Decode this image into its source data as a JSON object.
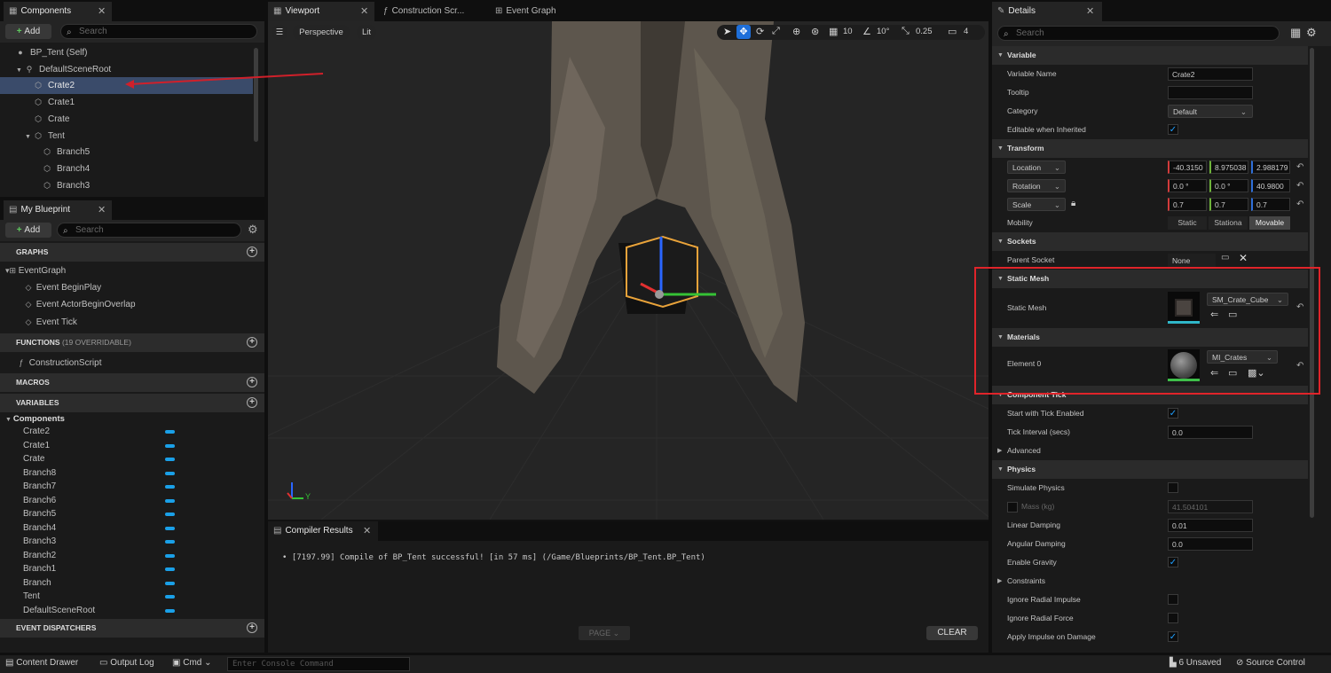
{
  "components": {
    "tab": "Components",
    "add": "Add",
    "search_placeholder": "Search",
    "tree": [
      {
        "label": "BP_Tent (Self)",
        "icon": "actor-icon",
        "indent": 0
      },
      {
        "label": "DefaultSceneRoot",
        "icon": "scene-root-icon",
        "indent": 1
      },
      {
        "label": "Crate2",
        "icon": "static-mesh-icon",
        "indent": 2,
        "selected": true
      },
      {
        "label": "Crate1",
        "icon": "static-mesh-icon",
        "indent": 2
      },
      {
        "label": "Crate",
        "icon": "static-mesh-icon",
        "indent": 2
      },
      {
        "label": "Tent",
        "icon": "static-mesh-icon",
        "indent": 2
      },
      {
        "label": "Branch5",
        "icon": "static-mesh-icon",
        "indent": 3
      },
      {
        "label": "Branch4",
        "icon": "static-mesh-icon",
        "indent": 3
      },
      {
        "label": "Branch3",
        "icon": "static-mesh-icon",
        "indent": 3
      }
    ]
  },
  "my_blueprint": {
    "tab": "My Blueprint",
    "add": "Add",
    "search_placeholder": "Search",
    "graphs_header": "GRAPHS",
    "event_graph": "EventGraph",
    "events": [
      "Event BeginPlay",
      "Event ActorBeginOverlap",
      "Event Tick"
    ],
    "functions_header": "FUNCTIONS",
    "functions_count": "(19 OVERRIDABLE)",
    "construction_script": "ConstructionScript",
    "macros_header": "MACROS",
    "variables_header": "VARIABLES",
    "components_group": "Components",
    "variables": [
      "Crate2",
      "Crate1",
      "Crate",
      "Branch8",
      "Branch7",
      "Branch6",
      "Branch5",
      "Branch4",
      "Branch3",
      "Branch2",
      "Branch1",
      "Branch",
      "Tent",
      "DefaultSceneRoot"
    ],
    "dispatchers_header": "EVENT DISPATCHERS",
    "var_color": "#1aa0e8"
  },
  "editor_tabs": {
    "viewport": "Viewport",
    "construction": "Construction Scr...",
    "event_graph": "Event Graph"
  },
  "viewport": {
    "perspective": "Perspective",
    "lit": "Lit",
    "grid_snap": "10",
    "rot_snap": "10°",
    "scale_snap": "0.25",
    "camera_speed": "4",
    "axis_y": "Y"
  },
  "compiler": {
    "tab": "Compiler Results",
    "message": "• [7197.99] Compile of BP_Tent successful! [in 57 ms] (/Game/Blueprints/BP_Tent.BP_Tent)",
    "page": "PAGE",
    "clear": "CLEAR"
  },
  "details": {
    "tab": "Details",
    "search_placeholder": "Search",
    "variable": {
      "header": "Variable",
      "name_label": "Variable Name",
      "name_value": "Crate2",
      "tooltip_label": "Tooltip",
      "category_label": "Category",
      "category_value": "Default",
      "editable_label": "Editable when Inherited",
      "editable_checked": true
    },
    "transform": {
      "header": "Transform",
      "location": "Location",
      "location_values": [
        "-40.3150",
        "8.975038",
        "2.988179"
      ],
      "rotation": "Rotation",
      "rotation_values": [
        "0.0 °",
        "0.0 °",
        "40.9800"
      ],
      "scale": "Scale",
      "scale_values": [
        "0.7",
        "0.7",
        "0.7"
      ],
      "mobility_label": "Mobility",
      "mobility_options": [
        "Static",
        "Stationa",
        "Movable"
      ],
      "mobility_selected": "Movable"
    },
    "sockets": {
      "header": "Sockets",
      "parent_label": "Parent Socket",
      "parent_value": "None"
    },
    "static_mesh": {
      "header": "Static Mesh",
      "label": "Static Mesh",
      "value": "SM_Crate_Cube"
    },
    "materials": {
      "header": "Materials",
      "label": "Element 0",
      "value": "MI_Crates"
    },
    "component_tick": {
      "header": "Component Tick",
      "start_label": "Start with Tick Enabled",
      "start_checked": true,
      "interval_label": "Tick Interval (secs)",
      "interval_value": "0.0"
    },
    "advanced": {
      "header": "Advanced"
    },
    "physics": {
      "header": "Physics",
      "simulate_label": "Simulate Physics",
      "mass_label": "Mass (kg)",
      "mass_value": "41.504101",
      "linear_label": "Linear Damping",
      "linear_value": "0.01",
      "angular_label": "Angular Damping",
      "angular_value": "0.0",
      "gravity_label": "Enable Gravity",
      "constraints_label": "Constraints",
      "ignore_impulse_label": "Ignore Radial Impulse",
      "ignore_force_label": "Ignore Radial Force",
      "apply_impulse_label": "Apply Impulse on Damage"
    }
  },
  "statusbar": {
    "content_drawer": "Content Drawer",
    "output_log": "Output Log",
    "cmd": "Cmd",
    "console_placeholder": "Enter Console Command",
    "unsaved": "6 Unsaved",
    "source_control": "Source Control"
  },
  "colors": {
    "accent": "#1f9fff",
    "highlight_box": "#e0242a",
    "annotation_arrow": "#d0202a",
    "selection": "#3a4b6a"
  }
}
